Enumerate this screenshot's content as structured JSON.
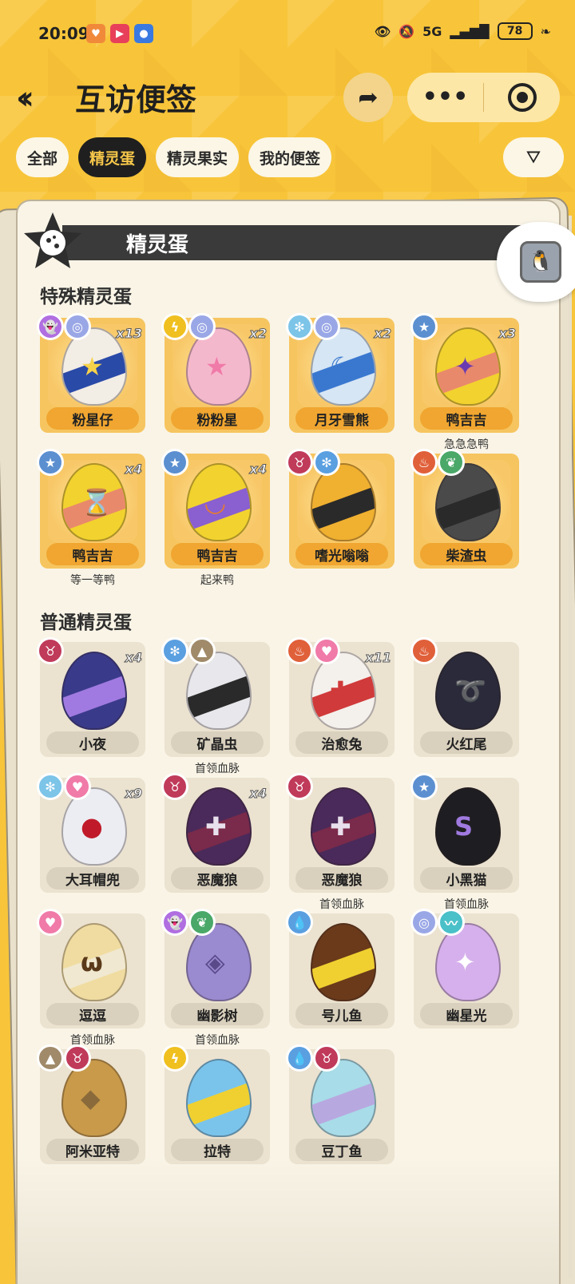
{
  "status_bar": {
    "time": "20:09",
    "network": "5G",
    "battery": "78",
    "app_icons": [
      "heart-app-icon",
      "play-app-icon",
      "circle-app-icon"
    ]
  },
  "header": {
    "title": "互访便签",
    "back_icon": "double-chevron-left-icon",
    "share_icon": "share-arrow-icon",
    "more_label": "•••",
    "target_icon": "target-icon"
  },
  "tabs": [
    {
      "label": "全部",
      "active": false
    },
    {
      "label": "精灵蛋",
      "active": true
    },
    {
      "label": "精灵果实",
      "active": false
    },
    {
      "label": "我的便签",
      "active": false
    }
  ],
  "filter_icon": "filter-icon",
  "section_banner": "精灵蛋",
  "special_title": "特殊精灵蛋",
  "normal_title": "普通精灵蛋",
  "colors": {
    "accent": "#f6c560",
    "dark": "#1f1f1f",
    "bg": "#f8c53a"
  },
  "special_eggs": [
    {
      "name": "粉星仔",
      "count": "x13",
      "attrs": [
        {
          "icon": "ghost-icon",
          "color": "#b06ee0"
        },
        {
          "icon": "spiral-icon",
          "color": "#9aa7e6"
        }
      ],
      "egg_color": "#f2ede5",
      "band": "#2a4aa8",
      "mark": "★",
      "mark_color": "#f6d24a",
      "subtitle": ""
    },
    {
      "name": "粉粉星",
      "count": "x2",
      "attrs": [
        {
          "icon": "lightning-icon",
          "color": "#f0c020"
        },
        {
          "icon": "spiral-icon",
          "color": "#9aa7e6"
        }
      ],
      "egg_color": "#f4b8cc",
      "band": "",
      "mark": "★",
      "mark_color": "#f07aa8",
      "subtitle": ""
    },
    {
      "name": "月牙雪熊",
      "count": "x2",
      "attrs": [
        {
          "icon": "snowflake-icon",
          "color": "#7cc4e8"
        },
        {
          "icon": "spiral-icon",
          "color": "#9aa7e6"
        }
      ],
      "egg_color": "#d6e6f4",
      "band": "#3a78d0",
      "mark": "☾",
      "mark_color": "#3a78d0",
      "subtitle": ""
    },
    {
      "name": "鸭吉吉",
      "count": "x3",
      "attrs": [
        {
          "icon": "star-icon",
          "color": "#5b8fd0"
        }
      ],
      "egg_color": "#f2d22e",
      "band": "#e9896c",
      "mark": "✦",
      "mark_color": "#6a3bb0",
      "subtitle": "急急急鸭"
    },
    {
      "name": "鸭吉吉",
      "count": "x4",
      "attrs": [
        {
          "icon": "star-icon",
          "color": "#5b8fd0"
        }
      ],
      "egg_color": "#f2d22e",
      "band": "#e9896c",
      "mark": "⌛",
      "mark_color": "#ffffff",
      "subtitle": "等一等鸭"
    },
    {
      "name": "鸭吉吉",
      "count": "x4",
      "attrs": [
        {
          "icon": "star-icon",
          "color": "#5b8fd0"
        }
      ],
      "egg_color": "#f2d22e",
      "band": "#8a5fd0",
      "mark": "◡",
      "mark_color": "#e07a3a",
      "subtitle": "起来鸭"
    },
    {
      "name": "嗜光嗡嗡",
      "count": "",
      "attrs": [
        {
          "icon": "demon-icon",
          "color": "#c03a5a"
        },
        {
          "icon": "snowflake-icon",
          "color": "#5a9fe0"
        }
      ],
      "egg_color": "#f0b030",
      "band": "#2a2a2a",
      "mark": "",
      "mark_color": "#2a2a2a",
      "subtitle": ""
    },
    {
      "name": "柴渣虫",
      "count": "",
      "attrs": [
        {
          "icon": "fire-icon",
          "color": "#e0603a"
        },
        {
          "icon": "leaf-icon",
          "color": "#4aa868"
        }
      ],
      "egg_color": "#4a4a4a",
      "band": "#2a2a2a",
      "mark": "",
      "mark_color": "#2a2a2a",
      "subtitle": ""
    }
  ],
  "normal_eggs": [
    {
      "name": "小夜",
      "count": "x4",
      "attrs": [
        {
          "icon": "demon-icon",
          "color": "#c03a5a"
        }
      ],
      "egg_color": "#3a3a8a",
      "band": "#a07ae0",
      "mark": "",
      "mark_color": "#fff",
      "subtitle": ""
    },
    {
      "name": "矿晶虫",
      "count": "",
      "attrs": [
        {
          "icon": "snowflake-icon",
          "color": "#5a9fe0"
        },
        {
          "icon": "mountain-icon",
          "color": "#a08a6a"
        }
      ],
      "egg_color": "#e8e8ec",
      "band": "#2a2a2a",
      "mark": "",
      "mark_color": "#222",
      "subtitle": "首领血脉"
    },
    {
      "name": "治愈兔",
      "count": "x11",
      "attrs": [
        {
          "icon": "fire-icon",
          "color": "#e0603a"
        },
        {
          "icon": "heart-icon",
          "color": "#f07aa8"
        }
      ],
      "egg_color": "#f4f0ec",
      "band": "#d03a3a",
      "mark": "✚",
      "mark_color": "#d03a3a",
      "subtitle": ""
    },
    {
      "name": "火红尾",
      "count": "",
      "attrs": [
        {
          "icon": "fire-icon",
          "color": "#e0603a"
        }
      ],
      "egg_color": "#2a2a3a",
      "band": "",
      "mark": "➰",
      "mark_color": "#f0904a",
      "subtitle": ""
    },
    {
      "name": "大耳帽兜",
      "count": "x9",
      "attrs": [
        {
          "icon": "snowflake-icon",
          "color": "#7cc4e8"
        },
        {
          "icon": "heart-icon",
          "color": "#f07aa8"
        }
      ],
      "egg_color": "#ecedf2",
      "band": "",
      "mark": "●",
      "mark_color": "#c01a2a",
      "subtitle": ""
    },
    {
      "name": "恶魔狼",
      "count": "x4",
      "attrs": [
        {
          "icon": "demon-icon",
          "color": "#c03a5a"
        }
      ],
      "egg_color": "#4a2a5a",
      "band": "#7a2a4a",
      "mark": "✚",
      "mark_color": "#e8e0ec",
      "subtitle": ""
    },
    {
      "name": "恶魔狼",
      "count": "",
      "attrs": [
        {
          "icon": "demon-icon",
          "color": "#c03a5a"
        }
      ],
      "egg_color": "#4a2a5a",
      "band": "#7a2a4a",
      "mark": "✚",
      "mark_color": "#e8e0ec",
      "subtitle": "首领血脉"
    },
    {
      "name": "小黑猫",
      "count": "",
      "attrs": [
        {
          "icon": "star-icon",
          "color": "#5b8fd0"
        }
      ],
      "egg_color": "#1e1e22",
      "band": "",
      "mark": "S",
      "mark_color": "#a07ae0",
      "subtitle": "首领血脉"
    },
    {
      "name": "逗逗",
      "count": "",
      "attrs": [
        {
          "icon": "heart-icon",
          "color": "#f07aa8"
        }
      ],
      "egg_color": "#f0dca0",
      "band": "#f0e8d0",
      "mark": "ω",
      "mark_color": "#5a3a1a",
      "subtitle": "首领血脉"
    },
    {
      "name": "幽影树",
      "count": "",
      "attrs": [
        {
          "icon": "ghost-icon",
          "color": "#b06ee0"
        },
        {
          "icon": "leaf-icon",
          "color": "#4aa868"
        }
      ],
      "egg_color": "#9a8ad0",
      "band": "",
      "mark": "◈",
      "mark_color": "#5a4a8a",
      "subtitle": "首领血脉"
    },
    {
      "name": "号儿鱼",
      "count": "",
      "attrs": [
        {
          "icon": "water-icon",
          "color": "#5a9fe0"
        }
      ],
      "egg_color": "#6a3a1a",
      "band": "#f0d030",
      "mark": "",
      "mark_color": "#fff",
      "subtitle": ""
    },
    {
      "name": "幽星光",
      "count": "",
      "attrs": [
        {
          "icon": "spiral-icon",
          "color": "#9aa7e6"
        },
        {
          "icon": "wing-icon",
          "color": "#4ac0c8"
        }
      ],
      "egg_color": "#d6b0ec",
      "band": "",
      "mark": "✦",
      "mark_color": "#ffffff",
      "subtitle": ""
    },
    {
      "name": "阿米亚特",
      "count": "",
      "attrs": [
        {
          "icon": "mountain-icon",
          "color": "#a08a6a"
        },
        {
          "icon": "demon-icon",
          "color": "#c03a5a"
        }
      ],
      "egg_color": "#c89a4a",
      "band": "",
      "mark": "◆",
      "mark_color": "#8a6a3a",
      "subtitle": ""
    },
    {
      "name": "拉特",
      "count": "",
      "attrs": [
        {
          "icon": "lightning-icon",
          "color": "#f0c020"
        }
      ],
      "egg_color": "#7ac4ec",
      "band": "#f0d030",
      "mark": "",
      "mark_color": "#fff",
      "subtitle": ""
    },
    {
      "name": "豆丁鱼",
      "count": "",
      "attrs": [
        {
          "icon": "water-icon",
          "color": "#5a9fe0"
        },
        {
          "icon": "demon-icon",
          "color": "#c03a5a"
        }
      ],
      "egg_color": "#a8dce8",
      "band": "#b8a8e0",
      "mark": "",
      "mark_color": "#fff",
      "subtitle": ""
    }
  ]
}
